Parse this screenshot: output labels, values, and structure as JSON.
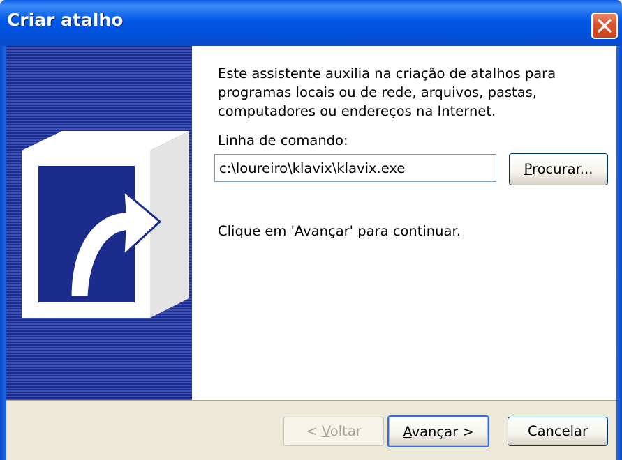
{
  "window": {
    "title": "Criar atalho",
    "icons": {
      "close": "close-icon",
      "banner": "shortcut-arrow-icon"
    },
    "colors": {
      "titlebar": "#0058E6",
      "close_button": "#D8542E",
      "banner": "#1C2C8C",
      "dialog_bg": "#ECE9D8"
    }
  },
  "content": {
    "intro": "Este assistente auxilia na criação de atalhos para programas locais ou de rede, arquivos, pastas, computadores ou endereços na Internet.",
    "cmd_label_access": "L",
    "cmd_label_rest": "inha de comando:",
    "cmd_value": "c:\\loureiro\\klavix\\klavix.exe",
    "browse_access": "P",
    "browse_rest": "rocurar...",
    "continue_text": "Clique em 'Avançar' para continuar."
  },
  "footer": {
    "back_prefix": "< ",
    "back_access": "V",
    "back_rest": "oltar",
    "next_access": "A",
    "next_rest": "vançar >",
    "cancel_label": "Cancelar"
  }
}
